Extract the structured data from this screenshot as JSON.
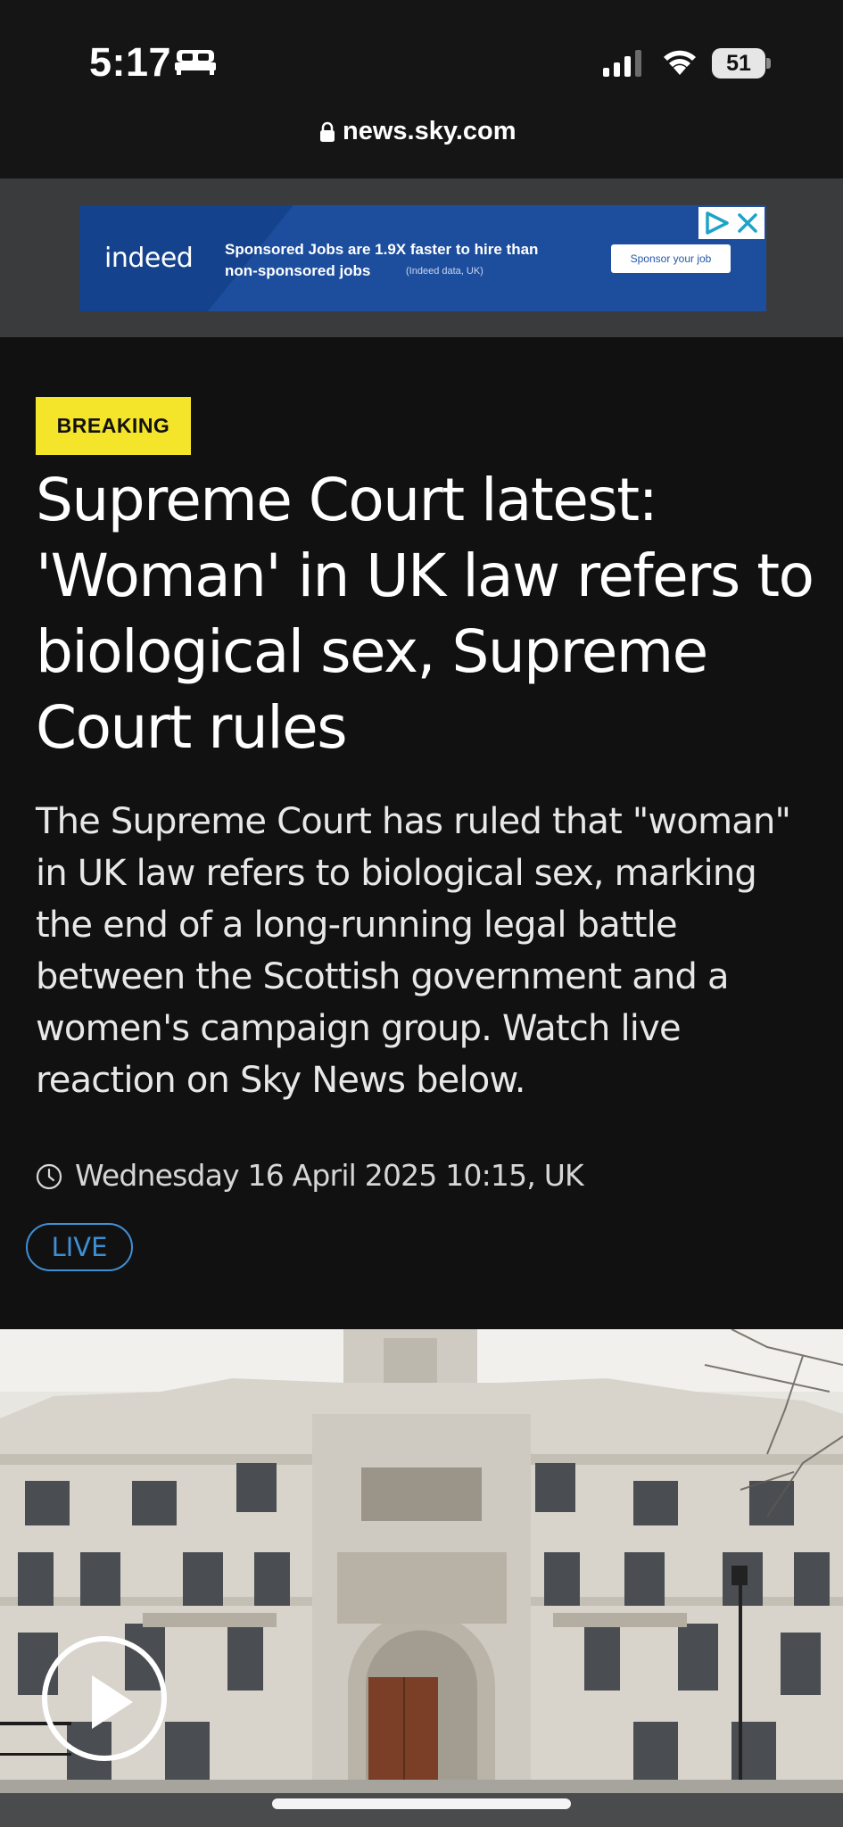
{
  "status_bar": {
    "time": "5:17",
    "battery_level": "51",
    "icons": [
      "bed-icon",
      "signal-icon",
      "wifi-icon",
      "battery-icon"
    ]
  },
  "browser": {
    "url": "news.sky.com",
    "lock_icon": "lock-icon"
  },
  "ad": {
    "brand": "indeed",
    "line1": "Sponsored Jobs are 1.9X faster to hire than",
    "line2": "non-sponsored jobs",
    "note": "(Indeed data, UK)",
    "cta": "Sponsor your job",
    "adchoices_icons": [
      "adchoices-icon",
      "close-icon"
    ]
  },
  "article": {
    "badge": "BREAKING",
    "headline": "Supreme Court latest: 'Woman' in UK law refers to biological sex, Supreme Court rules",
    "standfirst": "The Supreme Court has ruled that \"woman\" in UK law refers to biological sex, marking the end of a long-running legal battle between the Scottish government and a women's campaign group. Watch live reaction on Sky News below.",
    "timestamp": "Wednesday 16 April 2025 10:15, UK",
    "live_label": "LIVE"
  },
  "video": {
    "play_icon": "play-icon"
  },
  "colors": {
    "background": "#111112",
    "badge": "#f5e52a",
    "live": "#3f8fd4",
    "ad_blue": "#1d4e9e"
  }
}
